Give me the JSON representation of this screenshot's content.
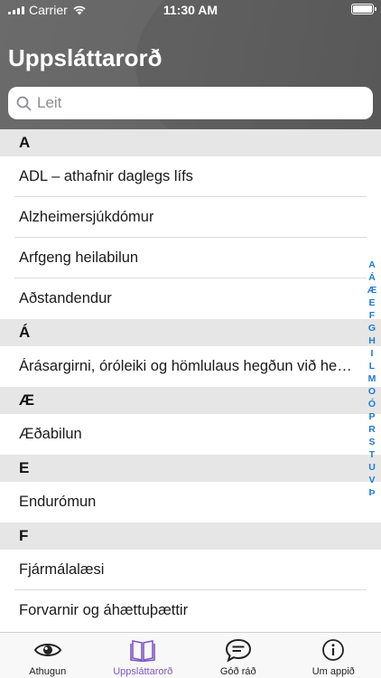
{
  "status_bar": {
    "carrier": "Carrier",
    "time": "11:30 AM"
  },
  "header": {
    "title": "Uppsláttarorð"
  },
  "search": {
    "placeholder": "Leit"
  },
  "sections": [
    {
      "letter": "A",
      "items": [
        "ADL – athafnir daglegs lífs",
        "Alzheimersjúkdómur",
        "Arfgeng heilabilun",
        "Aðstandendur"
      ]
    },
    {
      "letter": "Á",
      "items": [
        "Árásargirni, óróleiki og hömlulaus hegðun við heilabilun"
      ]
    },
    {
      "letter": "Æ",
      "items": [
        "Æðabilun"
      ]
    },
    {
      "letter": "E",
      "items": [
        "Endurómun"
      ]
    },
    {
      "letter": "F",
      "items": [
        "Fjármálalæsi",
        "Forvarnir og áhættuþættir"
      ]
    }
  ],
  "index_letters": [
    "A",
    "Á",
    "Æ",
    "E",
    "F",
    "G",
    "H",
    "I",
    "L",
    "M",
    "O",
    "Ó",
    "P",
    "R",
    "S",
    "T",
    "U",
    "V",
    "Þ"
  ],
  "tabs": [
    {
      "label": "Athugun",
      "icon": "eye-icon",
      "active": false
    },
    {
      "label": "Uppsláttarorð",
      "icon": "book-icon",
      "active": true
    },
    {
      "label": "Góð ráð",
      "icon": "chat-bubble-icon",
      "active": false
    },
    {
      "label": "Um appið",
      "icon": "info-icon",
      "active": false
    }
  ],
  "colors": {
    "header_bg": "#666666",
    "accent": "#7e57c2",
    "index_color": "#1f7ad6",
    "section_bg": "#e6e6e6"
  }
}
